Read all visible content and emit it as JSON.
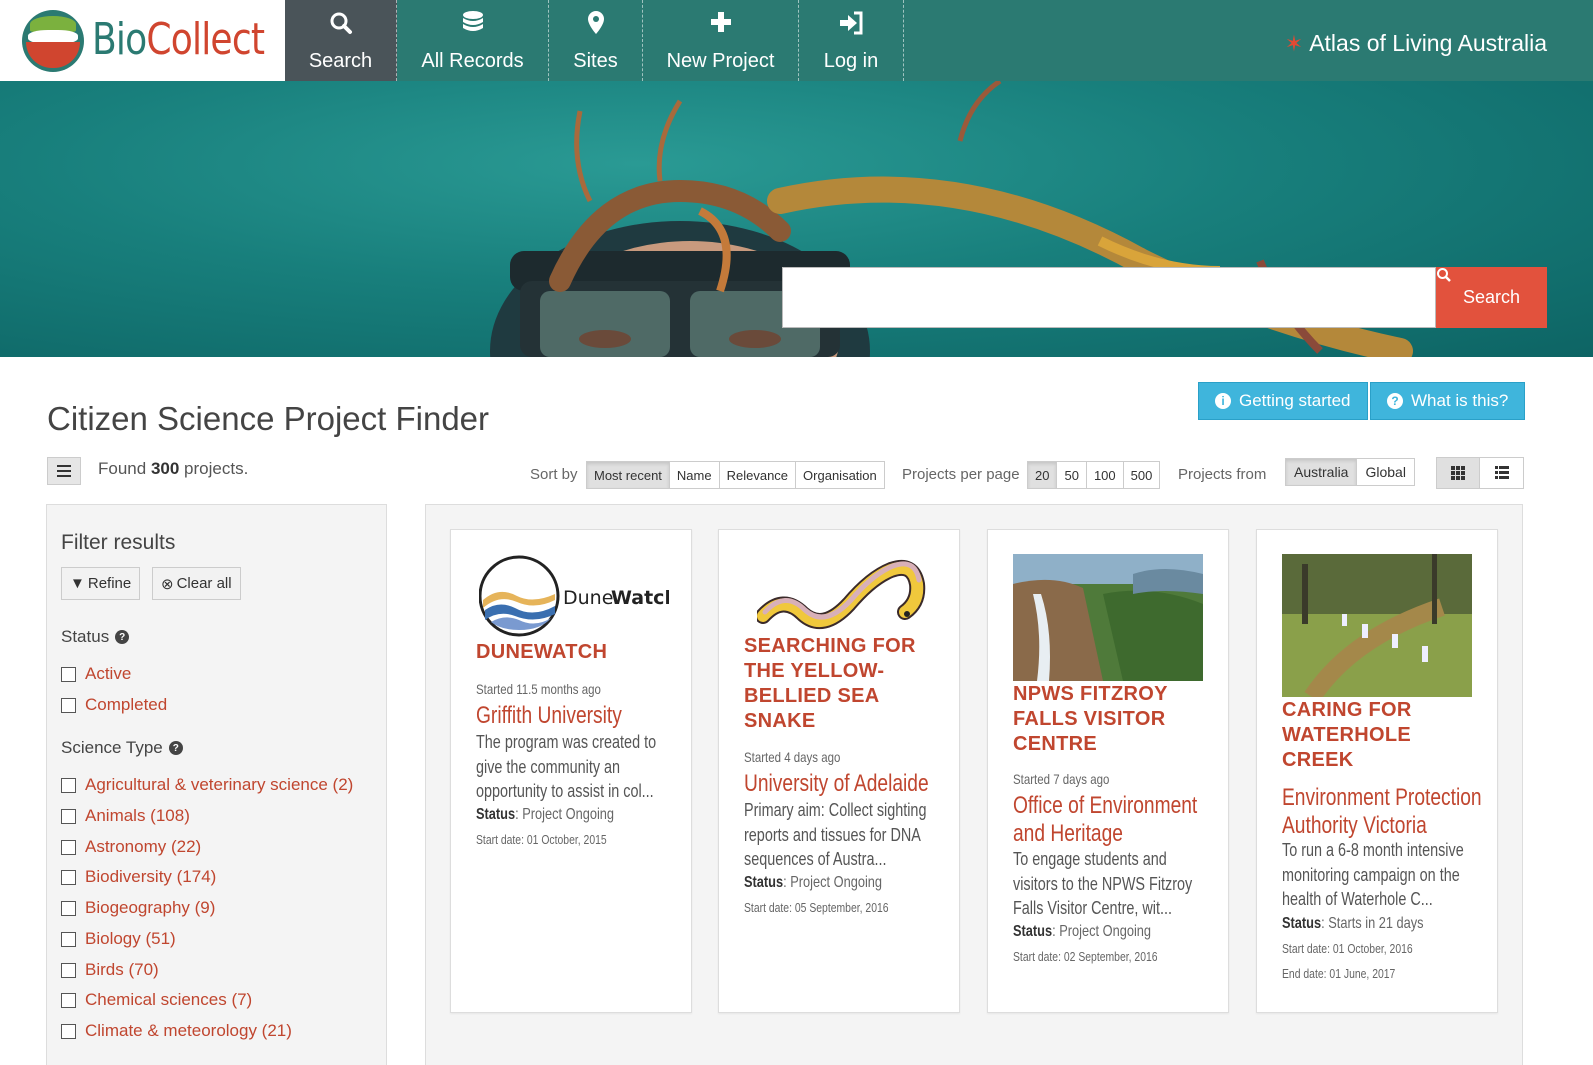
{
  "brand": {
    "bio": "Bio",
    "collect": "Collect"
  },
  "nav": [
    {
      "label": "Search",
      "icon": "search-icon"
    },
    {
      "label": "All Records",
      "icon": "database-icon"
    },
    {
      "label": "Sites",
      "icon": "map-marker-icon"
    },
    {
      "label": "New Project",
      "icon": "plus-icon"
    },
    {
      "label": "Log in",
      "icon": "sign-in-icon"
    }
  ],
  "ala_link": "Atlas of Living Australia",
  "hero": {
    "search_value": "",
    "search_button": "Search"
  },
  "page_title": "Citizen Science Project Finder",
  "help": {
    "getting_started": "Getting started",
    "what_is_this": "What is this?"
  },
  "toolbar": {
    "found_prefix": "Found",
    "found_count": "300",
    "found_suffix": "projects.",
    "sort_label": "Sort by",
    "sort_options": [
      "Most recent",
      "Name",
      "Relevance",
      "Organisation"
    ],
    "sort_selected": "Most recent",
    "per_page_label": "Projects per page",
    "per_page_options": [
      "20",
      "50",
      "100",
      "500"
    ],
    "per_page_selected": "20",
    "from_label": "Projects from",
    "from_options": [
      "Australia",
      "Global"
    ],
    "from_selected": "Australia"
  },
  "filters": {
    "title": "Filter results",
    "refine": "Refine",
    "clear_all": "Clear all",
    "status_heading": "Status",
    "status_options": [
      "Active",
      "Completed"
    ],
    "science_heading": "Science Type",
    "science_options": [
      "Agricultural & veterinary science (2)",
      "Animals (108)",
      "Astronomy (22)",
      "Biodiversity (174)",
      "Biogeography (9)",
      "Biology (51)",
      "Birds (70)",
      "Chemical sciences (7)",
      "Climate & meteorology (21)"
    ]
  },
  "projects": [
    {
      "logo_text_a": "Dune",
      "logo_text_b": "Watch",
      "title": "DUNEWATCH",
      "started": "Started 11.5 months ago",
      "org": "Griffith University",
      "desc": "The program was created to give the community an opportunity to assist in col...",
      "status_label": "Status",
      "status": ": Project Ongoing",
      "start_date": "Start date: 01 October, 2015",
      "end_date": ""
    },
    {
      "title": "SEARCHING FOR THE YELLOW-BELLIED SEA SNAKE",
      "started": "Started 4 days ago",
      "org": "University of Adelaide",
      "desc": "Primary aim: Collect sighting reports and tissues for DNA sequences of Austra...",
      "status_label": "Status",
      "status": ": Project Ongoing",
      "start_date": "Start date: 05 September, 2016",
      "end_date": ""
    },
    {
      "title": "NPWS FITZROY FALLS VISITOR CENTRE",
      "started": "Started 7 days ago",
      "org": "Office of Environment and Heritage",
      "desc": "To engage students and visitors to the NPWS Fitzroy Falls Visitor Centre, wit...",
      "status_label": "Status",
      "status": ": Project Ongoing",
      "start_date": "Start date: 02 September, 2016",
      "end_date": ""
    },
    {
      "title": "CARING FOR WATERHOLE CREEK",
      "started": "",
      "org": "Environment Protection Authority Victoria",
      "desc": "To run a 6-8 month intensive monitoring campaign on the health of Waterhole C...",
      "status_label": "Status",
      "status": ": Starts in 21 days",
      "start_date": "Start date: 01 October, 2016",
      "end_date": "End date: 01 June, 2017"
    }
  ],
  "colors": {
    "nav": "#2b7a72",
    "accent": "#c0462f",
    "search_button": "#e2523d",
    "help_button": "#3fb5dc"
  }
}
